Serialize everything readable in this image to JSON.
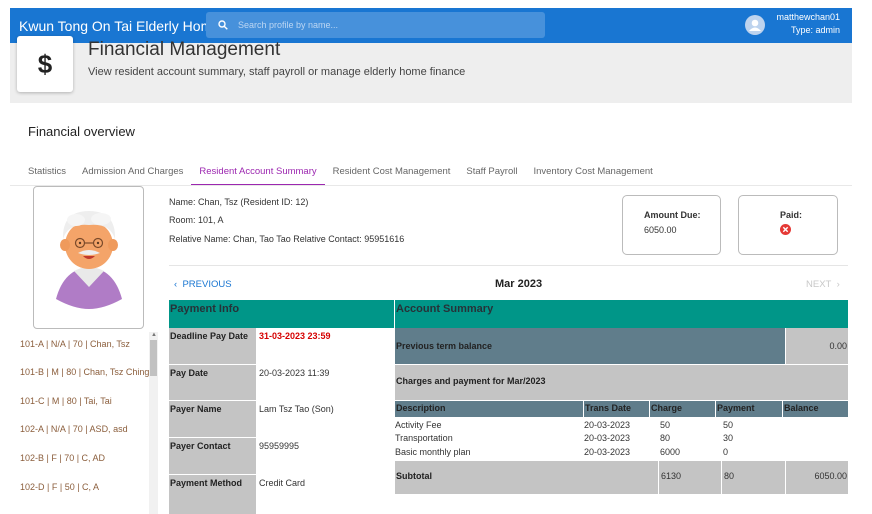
{
  "appbar": {
    "title": "Kwun Tong On Tai Elderly Home",
    "search_placeholder": "Search profile by name...",
    "username": "matthewchan01",
    "user_type": "Type: admin"
  },
  "header": {
    "icon_symbol": "$",
    "title": "Financial Management",
    "subtitle": "View resident account summary, staff payroll or manage elderly home finance"
  },
  "section_title": "Financial overview",
  "tabs": [
    "Statistics",
    "Admission And Charges",
    "Resident Account Summary",
    "Resident Cost Management",
    "Staff Payroll",
    "Inventory Cost Management"
  ],
  "active_tab": "Resident Account Summary",
  "residents": [
    "101-A | N/A | 70 | Chan, Tsz",
    "101-B | M | 80 | Chan, Tsz Ching",
    "101-C | M | 80 | Tai, Tai",
    "102-A | N/A | 70 | ASD, asd",
    "102-B | F | 70 | C, AD",
    "102-D | F | 50 | C, A"
  ],
  "resident": {
    "name_line": "Name: Chan, Tsz (Resident ID: 12)",
    "room_line": "Room: 101, A",
    "relative_line": "Relative Name: Chan, Tao Tao Relative Contact: 95951616"
  },
  "amount_due": {
    "label": "Amount Due:",
    "value": "6050.00"
  },
  "paid": {
    "label": "Paid:"
  },
  "nav": {
    "prev": "PREVIOUS",
    "month": "Mar 2023",
    "next": "NEXT"
  },
  "payment_info": {
    "title": "Payment Info",
    "rows": [
      {
        "label": "Deadline Pay Date",
        "value": "31-03-2023 23:59"
      },
      {
        "label": "Pay Date",
        "value": "20-03-2023 11:39"
      },
      {
        "label": "Payer Name",
        "value": "Lam Tsz Tao (Son)"
      },
      {
        "label": "Payer Contact",
        "value": "95959995"
      },
      {
        "label": "Payment Method",
        "value": "Credit Card"
      }
    ]
  },
  "account_summary": {
    "title": "Account Summary",
    "previous_label": "Previous term balance",
    "previous_value": "0.00",
    "charges_label": "Charges and payment for Mar/2023",
    "columns": [
      "Description",
      "Trans Date",
      "Charge",
      "Payment",
      "Balance"
    ],
    "items": [
      {
        "description": "Activity Fee",
        "date": "20-03-2023",
        "charge": "50",
        "payment": "50"
      },
      {
        "description": "Transportation",
        "date": "20-03-2023",
        "charge": "80",
        "payment": "30"
      },
      {
        "description": "Basic monthly plan",
        "date": "20-03-2023",
        "charge": "6000",
        "payment": "0"
      }
    ],
    "subtotal_label": "Subtotal",
    "subtotal_charge": "6130",
    "subtotal_payment": "80",
    "subtotal_balance": "6050.00"
  },
  "colors": {
    "appbar": "#1976d2",
    "accent": "#9c27b0",
    "teal": "#009688",
    "slate": "#607d8b",
    "deadline": "#d50000"
  }
}
